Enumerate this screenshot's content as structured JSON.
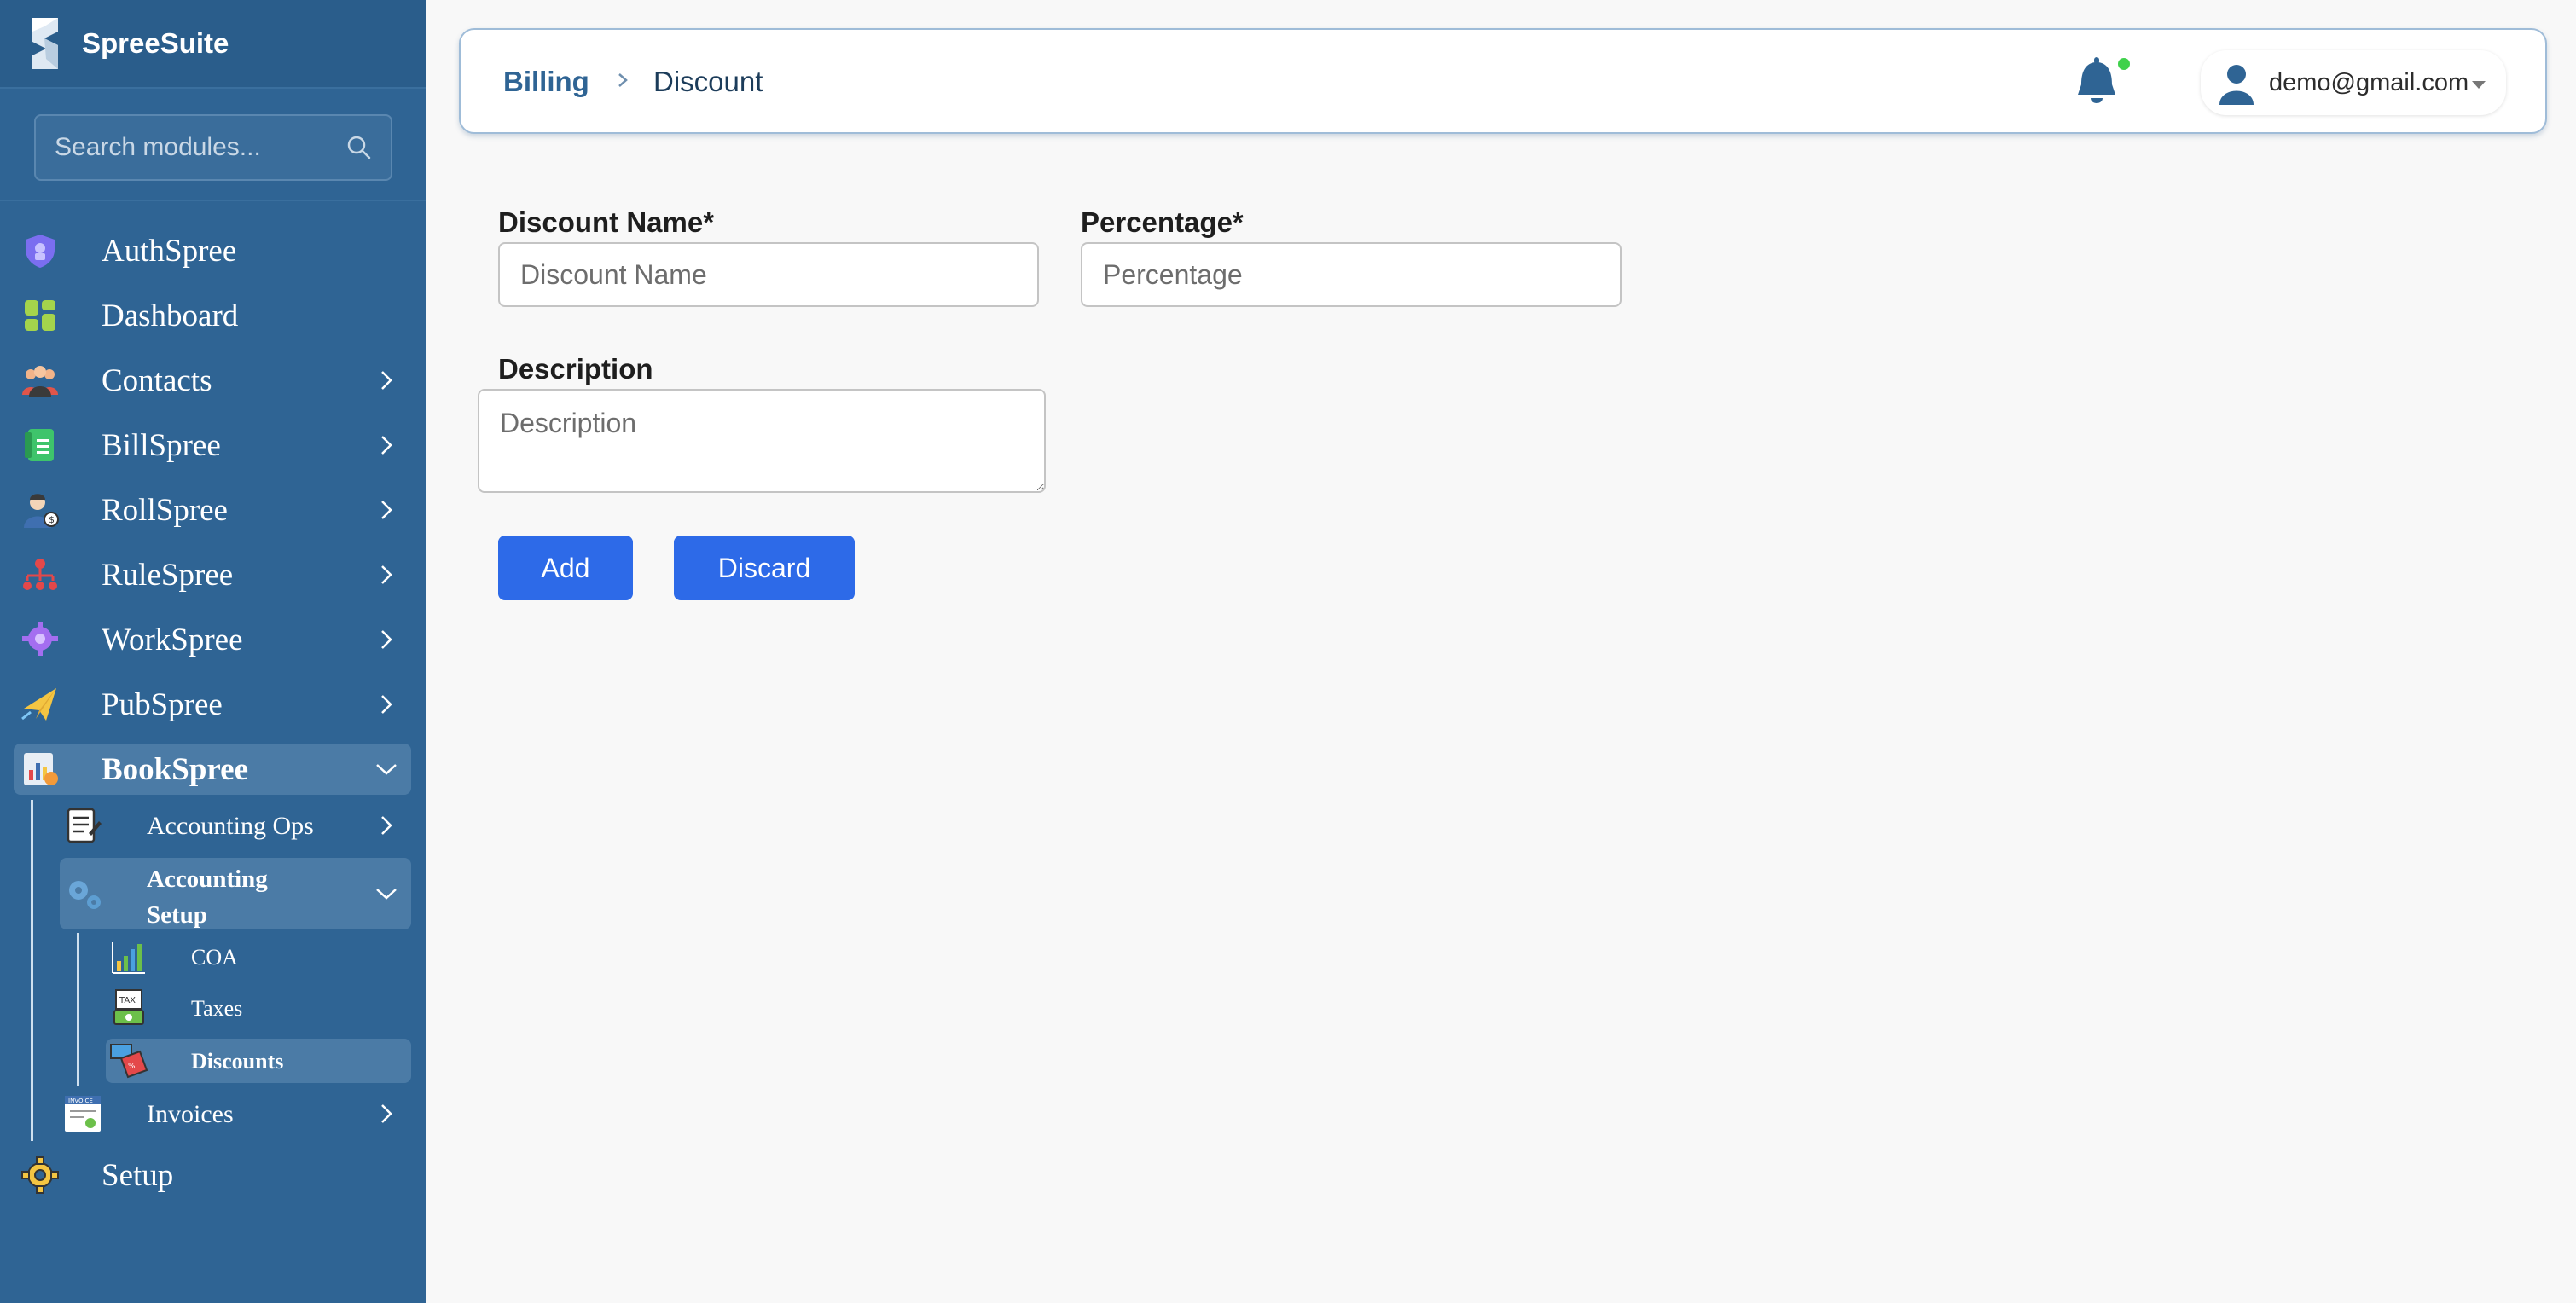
{
  "app": {
    "name": "SpreeSuite"
  },
  "search": {
    "placeholder": "Search modules..."
  },
  "sidebar": {
    "items": [
      {
        "label": "AuthSpree"
      },
      {
        "label": "Dashboard"
      },
      {
        "label": "Contacts"
      },
      {
        "label": "BillSpree"
      },
      {
        "label": "RollSpree"
      },
      {
        "label": "RuleSpree"
      },
      {
        "label": "WorkSpree"
      },
      {
        "label": "PubSpree"
      },
      {
        "label": "BookSpree"
      },
      {
        "label": "Setup"
      }
    ],
    "bookspree_children": [
      {
        "label": "Accounting Ops"
      },
      {
        "label_line1": "Accounting",
        "label_line2": "Setup"
      },
      {
        "label": "Invoices"
      }
    ],
    "setup_children": [
      {
        "label": "COA"
      },
      {
        "label": "Taxes"
      },
      {
        "label": "Discounts"
      }
    ]
  },
  "header": {
    "breadcrumb_parent": "Billing",
    "breadcrumb_current": "Discount",
    "user_email": "demo@gmail.com"
  },
  "form": {
    "discount_name_label": "Discount Name*",
    "discount_name_placeholder": "Discount Name",
    "percentage_label": "Percentage*",
    "percentage_placeholder": "Percentage",
    "description_label": "Description",
    "description_placeholder": "Description",
    "add_label": "Add",
    "discard_label": "Discard"
  },
  "colors": {
    "sidebar_bg": "#2f6494",
    "accent": "#2d6ae8",
    "notification_dot": "#3fd14b"
  }
}
